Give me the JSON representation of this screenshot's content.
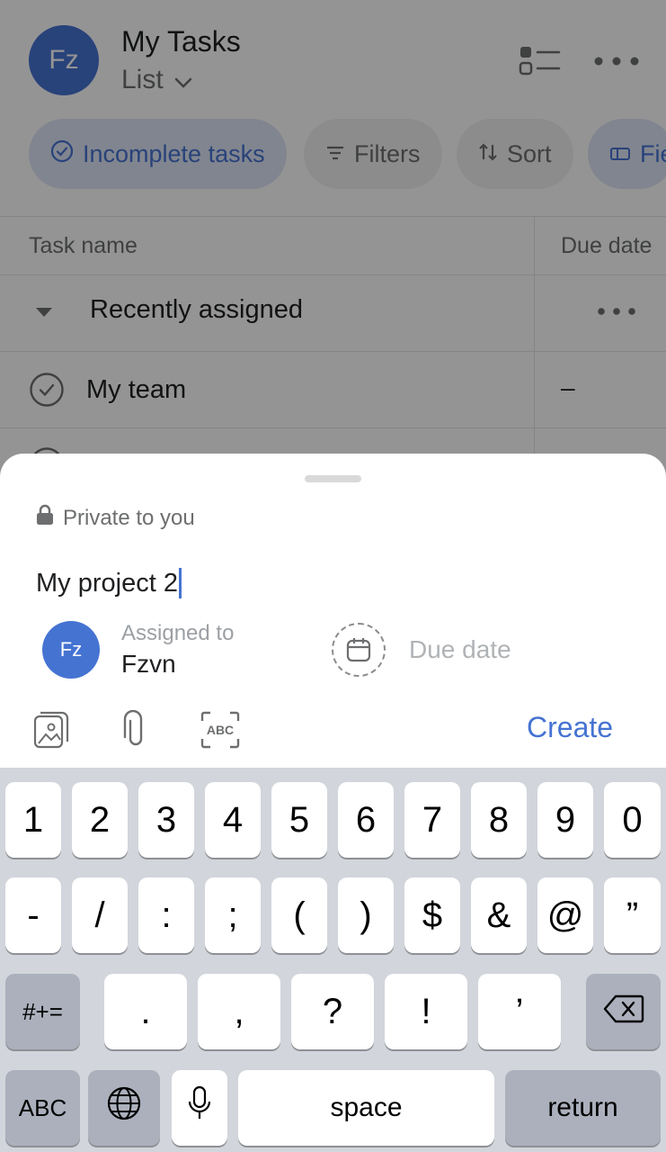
{
  "app": {
    "avatar_initials": "Fz",
    "title": "My Tasks",
    "view_label": "List",
    "chips": [
      "Incomplete tasks",
      "Filters",
      "Sort",
      "Fie"
    ],
    "columns": [
      "Task name",
      "Due date"
    ],
    "section_label": "Recently assigned",
    "rows": [
      {
        "name": "My team",
        "due": "–"
      }
    ]
  },
  "sheet": {
    "privacy_label": "Private to you",
    "task_name_value": "My project 2",
    "assigned_label": "Assigned to",
    "assignee_name": "Fzvn",
    "assignee_initials": "Fz",
    "due_placeholder": "Due date",
    "create_label": "Create"
  },
  "keyboard": {
    "row1": [
      "1",
      "2",
      "3",
      "4",
      "5",
      "6",
      "7",
      "8",
      "9",
      "0"
    ],
    "row2": [
      "-",
      "/",
      ":",
      ";",
      "(",
      ")",
      "$",
      "&",
      "@",
      "”"
    ],
    "row3": [
      ".",
      ",",
      "?",
      "!",
      "’"
    ],
    "symbols_key": "#+=",
    "abc_key": "ABC",
    "space_key": "space",
    "return_key": "return"
  },
  "colors": {
    "accent": "#4573d2",
    "overlay": "rgba(0,0,0,0.42)",
    "keyboard_bg": "#d2d5db"
  }
}
